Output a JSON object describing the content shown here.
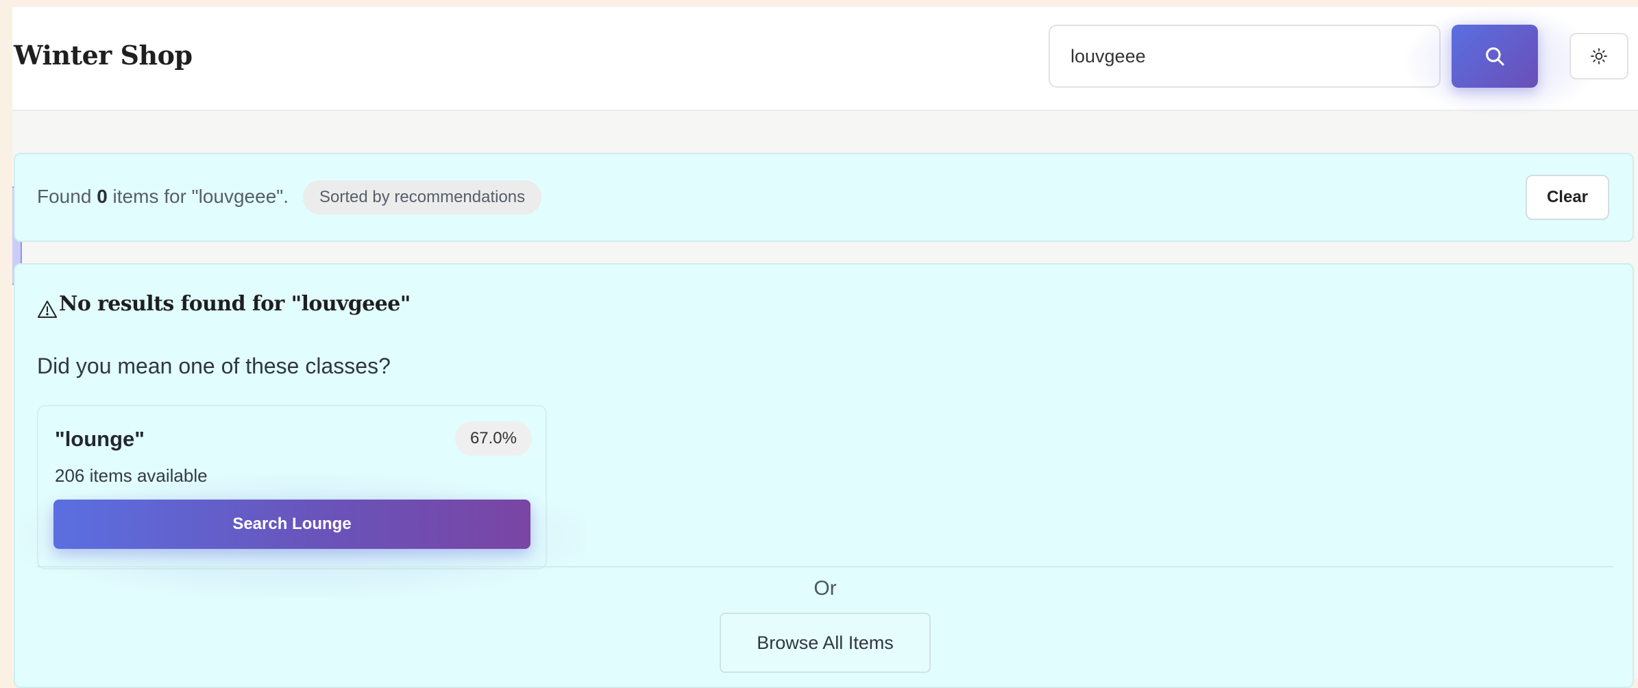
{
  "header": {
    "brand": "Winter Shop",
    "search": {
      "value": "louvgeee",
      "placeholder": ""
    },
    "search_button_icon": "search-icon",
    "theme_button_icon": "sun-icon"
  },
  "results_bar": {
    "found_prefix": "Found",
    "count": "0",
    "found_suffix": "items for \"louvgeee\".",
    "sort_badge": "Sorted by recommendations",
    "clear_label": "Clear"
  },
  "no_results": {
    "warning_icon": "warning-icon",
    "title": "No results found for \"louvgeee\"",
    "did_you_mean": "Did you mean one of these classes?",
    "suggestions": [
      {
        "name": "\"lounge\"",
        "score": "67.0%",
        "count": "206 items available",
        "button_label": "Search Lounge"
      }
    ],
    "or_label": "Or",
    "browse_label": "Browse All Items"
  },
  "colors": {
    "accent_start": "#5a6fe0",
    "accent_end": "#6a4fb8",
    "panel_bg": "#e2fdfd",
    "page_bg": "#faf0e4"
  }
}
